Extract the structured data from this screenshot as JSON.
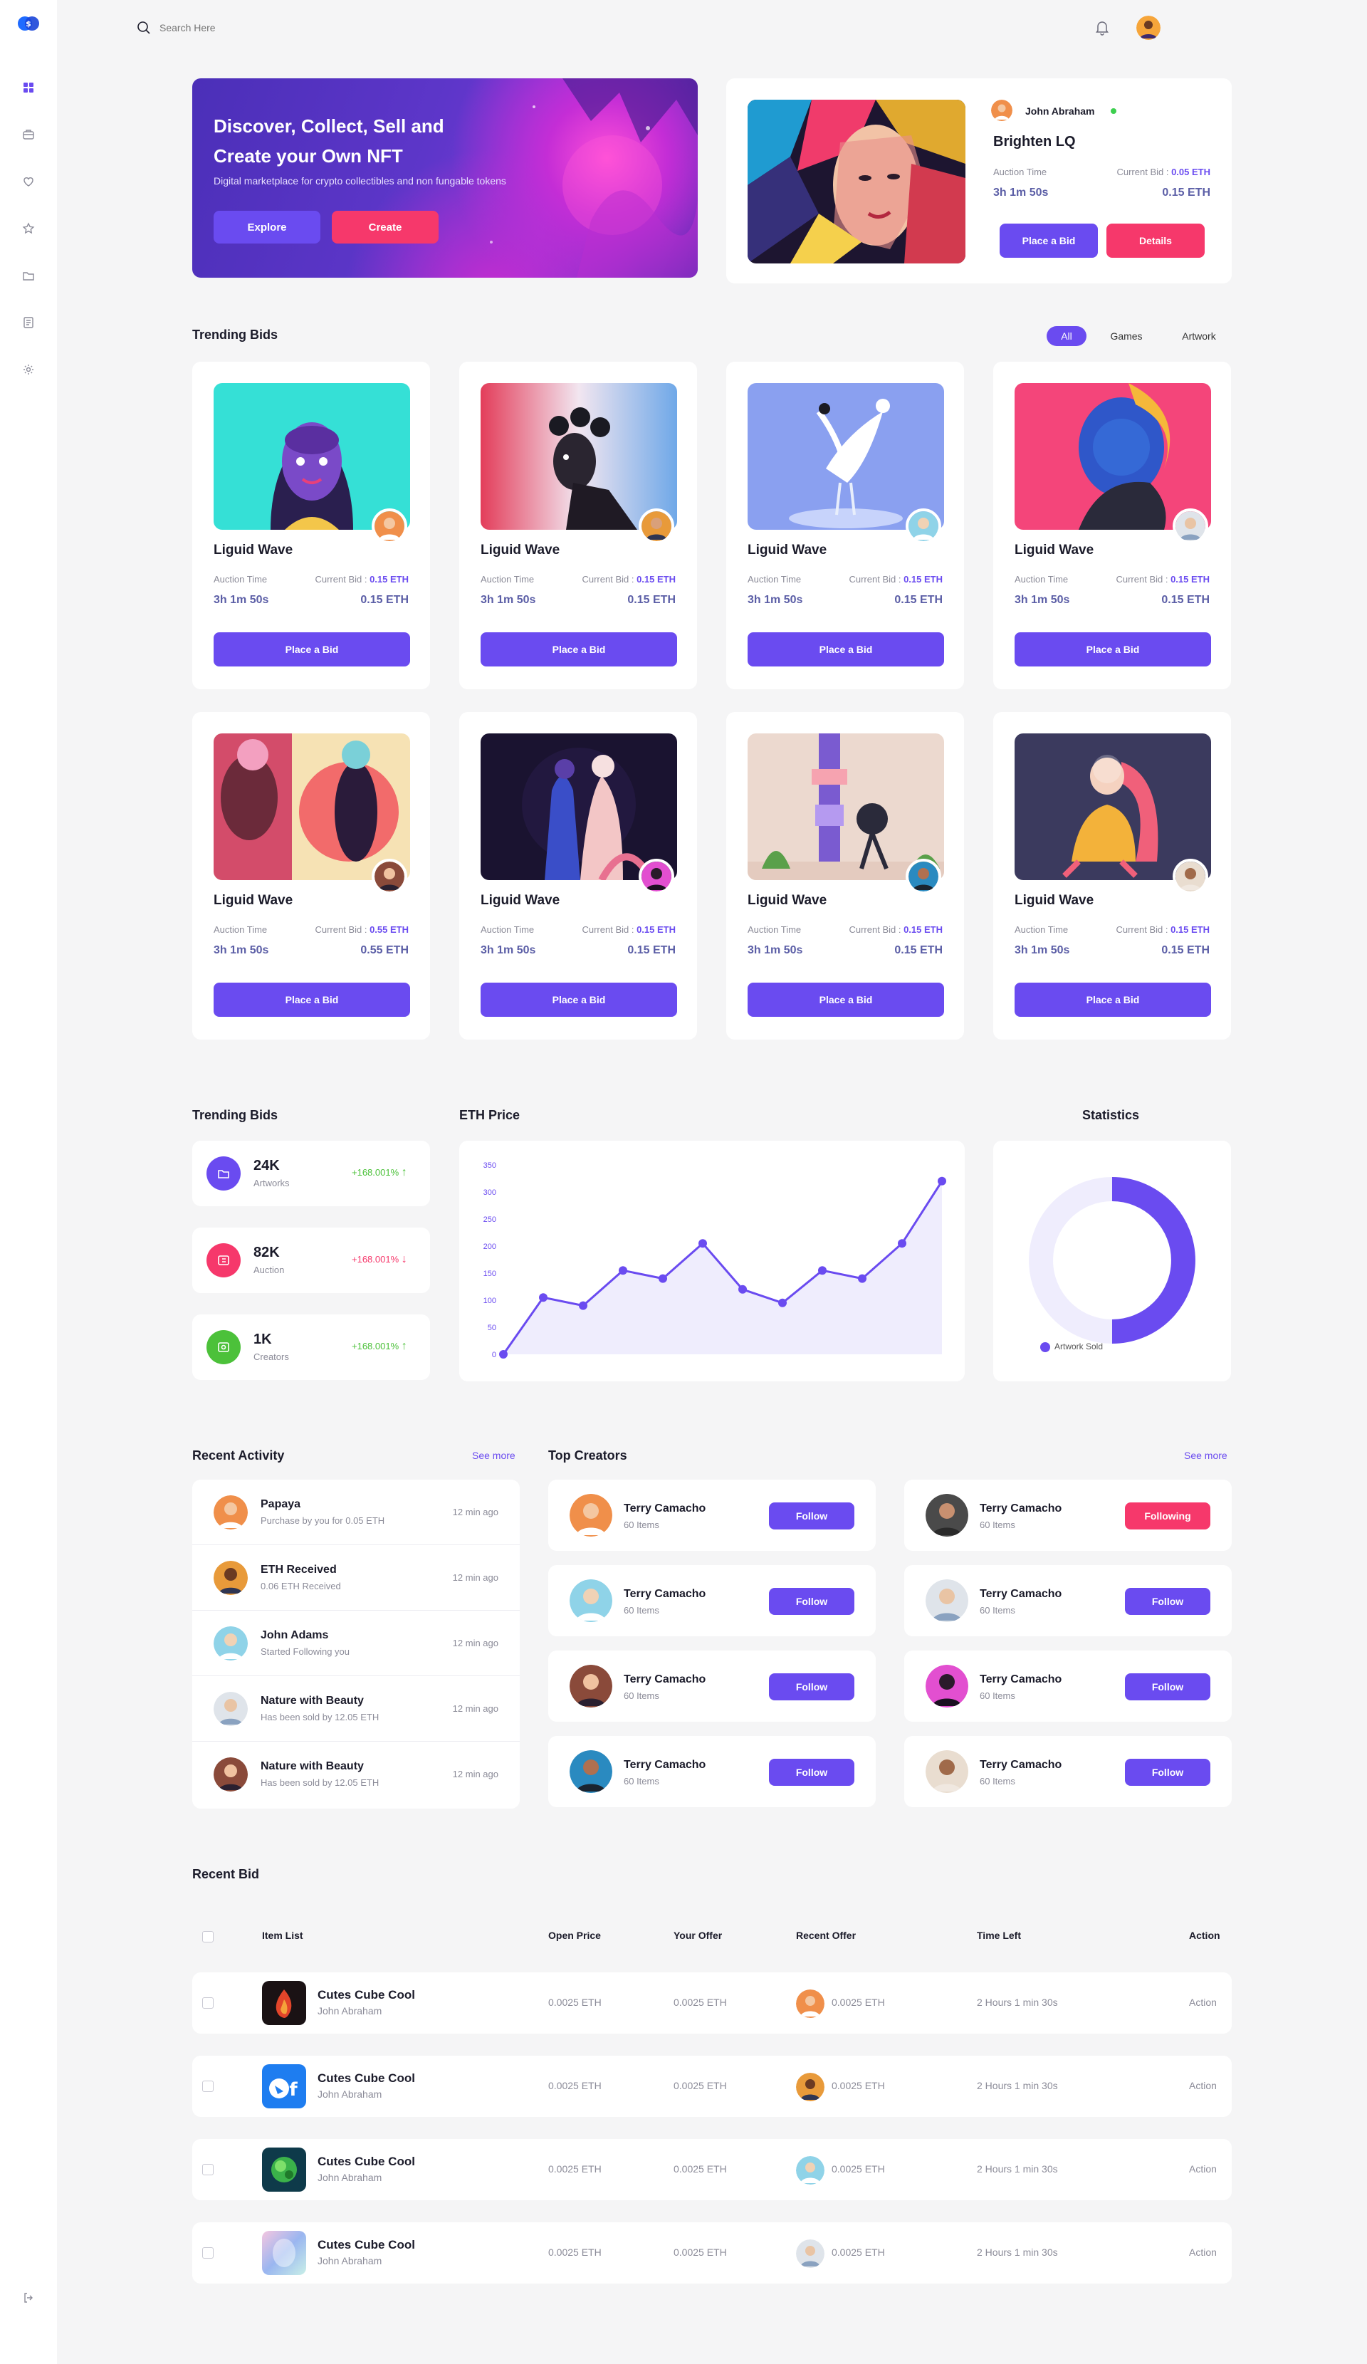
{
  "search": {
    "placeholder": "Search Here"
  },
  "hero": {
    "title": "Discover, Collect, Sell and Create your Own NFT",
    "subtitle": "Digital marketplace for crypto collectibles and non fungable tokens",
    "explore_label": "Explore",
    "create_label": "Create"
  },
  "featured": {
    "owner": "John Abraham",
    "title": "Brighten LQ",
    "auction_label": "Auction Time",
    "bid_label": "Current Bid : ",
    "bid_value": "0.05 ETH",
    "time": "3h 1m 50s",
    "price": "0.15 ETH",
    "place_bid_label": "Place a Bid",
    "details_label": "Details"
  },
  "trending": {
    "title": "Trending Bids",
    "filters": [
      "All",
      "Games",
      "Artwork"
    ],
    "cards": [
      {
        "title": "Liguid Wave",
        "auction_label": "Auction Time",
        "bid_label": "Current Bid : ",
        "bid_value": "0.15 ETH",
        "time": "3h 1m 50s",
        "price": "0.15 ETH",
        "button": "Place a Bid"
      },
      {
        "title": "Liguid Wave",
        "auction_label": "Auction Time",
        "bid_label": "Current Bid : ",
        "bid_value": "0.15 ETH",
        "time": "3h 1m 50s",
        "price": "0.15 ETH",
        "button": "Place a Bid"
      },
      {
        "title": "Liguid Wave",
        "auction_label": "Auction Time",
        "bid_label": "Current Bid : ",
        "bid_value": "0.15 ETH",
        "time": "3h 1m 50s",
        "price": "0.15 ETH",
        "button": "Place a Bid"
      },
      {
        "title": "Liguid Wave",
        "auction_label": "Auction Time",
        "bid_label": "Current Bid : ",
        "bid_value": "0.15 ETH",
        "time": "3h 1m 50s",
        "price": "0.15 ETH",
        "button": "Place a Bid"
      },
      {
        "title": "Liguid Wave",
        "auction_label": "Auction Time",
        "bid_label": "Current Bid : ",
        "bid_value": "0.55 ETH",
        "time": "3h 1m 50s",
        "price": "0.55 ETH",
        "button": "Place a Bid"
      },
      {
        "title": "Liguid Wave",
        "auction_label": "Auction Time",
        "bid_label": "Current Bid : ",
        "bid_value": "0.15 ETH",
        "time": "3h 1m 50s",
        "price": "0.15 ETH",
        "button": "Place a Bid"
      },
      {
        "title": "Liguid Wave",
        "auction_label": "Auction Time",
        "bid_label": "Current Bid : ",
        "bid_value": "0.15 ETH",
        "time": "3h 1m 50s",
        "price": "0.15 ETH",
        "button": "Place a Bid"
      },
      {
        "title": "Liguid Wave",
        "auction_label": "Auction Time",
        "bid_label": "Current Bid : ",
        "bid_value": "0.15 ETH",
        "time": "3h 1m 50s",
        "price": "0.15 ETH",
        "button": "Place a Bid"
      }
    ]
  },
  "stats_section": {
    "title": "Trending Bids",
    "items": [
      {
        "value": "24K",
        "label": "Artworks",
        "change": "+168.001%",
        "direction": "↑",
        "color": "#6a4bf0"
      },
      {
        "value": "82K",
        "label": "Auction",
        "change": "+168.001%",
        "direction": "↓",
        "color": "#f6386b"
      },
      {
        "value": "1K",
        "label": "Creators",
        "change": "+168.001%",
        "direction": "↑",
        "color": "#4cc13a"
      }
    ]
  },
  "eth_price": {
    "title": "ETH Price",
    "chart_data": {
      "type": "area",
      "title": "ETH Price",
      "x": [
        0,
        1,
        2,
        3,
        4,
        5,
        6,
        7,
        8,
        9,
        10,
        11
      ],
      "values": [
        0,
        105,
        90,
        155,
        140,
        205,
        120,
        95,
        155,
        140,
        205,
        320
      ],
      "ylim": [
        0,
        350
      ],
      "yticks": [
        0,
        50,
        100,
        150,
        200,
        250,
        300,
        350
      ],
      "grid": false,
      "color": "#6a4bf0"
    }
  },
  "statistics": {
    "title": "Statistics",
    "chart_data": {
      "type": "pie",
      "title": "Statistics",
      "categories": [
        "Artwork Sold",
        ""
      ],
      "values": [
        50,
        50
      ],
      "legend": "bottom-left",
      "colors": [
        "#6a4bf0",
        "#efedfd"
      ]
    }
  },
  "activity": {
    "title": "Recent Activity",
    "see_more": "See more",
    "items": [
      {
        "name": "Papaya",
        "sub": "Purchase by you for 0.05 ETH",
        "time": "12 min ago"
      },
      {
        "name": "ETH Received",
        "sub": "0.06 ETH Received",
        "time": "12 min ago"
      },
      {
        "name": "John Adams",
        "sub": "Started Following you",
        "time": "12 min ago"
      },
      {
        "name": "Nature with Beauty",
        "sub": "Has been sold by 12.05 ETH",
        "time": "12 min ago"
      },
      {
        "name": "Nature with Beauty",
        "sub": "Has been sold by 12.05 ETH",
        "time": "12 min ago"
      }
    ]
  },
  "creators": {
    "title": "Top Creators",
    "see_more": "See more",
    "items": [
      {
        "name": "Terry Camacho",
        "sub": "60 Items",
        "button": "Follow"
      },
      {
        "name": "Terry Camacho",
        "sub": "60 Items",
        "button": "Following"
      },
      {
        "name": "Terry Camacho",
        "sub": "60 Items",
        "button": "Follow"
      },
      {
        "name": "Terry Camacho",
        "sub": "60 Items",
        "button": "Follow"
      },
      {
        "name": "Terry Camacho",
        "sub": "60 Items",
        "button": "Follow"
      },
      {
        "name": "Terry Camacho",
        "sub": "60 Items",
        "button": "Follow"
      },
      {
        "name": "Terry Camacho",
        "sub": "60 Items",
        "button": "Follow"
      },
      {
        "name": "Terry Camacho",
        "sub": "60 Items",
        "button": "Follow"
      }
    ]
  },
  "recent_bid": {
    "title": "Recent Bid",
    "headers": {
      "item": "Item List",
      "open": "Open Price",
      "offer": "Your Offer",
      "recent": "Recent Offer",
      "time": "Time Left",
      "action": "Action"
    },
    "rows": [
      {
        "name": "Cutes Cube Cool",
        "owner": "John Abraham",
        "open": "0.0025 ETH",
        "offer": "0.0025 ETH",
        "recent": "0.0025 ETH",
        "time": "2 Hours 1 min 30s",
        "action": "Action"
      },
      {
        "name": "Cutes Cube Cool",
        "owner": "John Abraham",
        "open": "0.0025 ETH",
        "offer": "0.0025 ETH",
        "recent": "0.0025 ETH",
        "time": "2 Hours 1 min 30s",
        "action": "Action"
      },
      {
        "name": "Cutes Cube Cool",
        "owner": "John Abraham",
        "open": "0.0025 ETH",
        "offer": "0.0025 ETH",
        "recent": "0.0025 ETH",
        "time": "2 Hours 1 min 30s",
        "action": "Action"
      },
      {
        "name": "Cutes Cube Cool",
        "owner": "John Abraham",
        "open": "0.0025 ETH",
        "offer": "0.0025 ETH",
        "recent": "0.0025 ETH",
        "time": "2 Hours 1 min 30s",
        "action": "Action"
      }
    ]
  }
}
